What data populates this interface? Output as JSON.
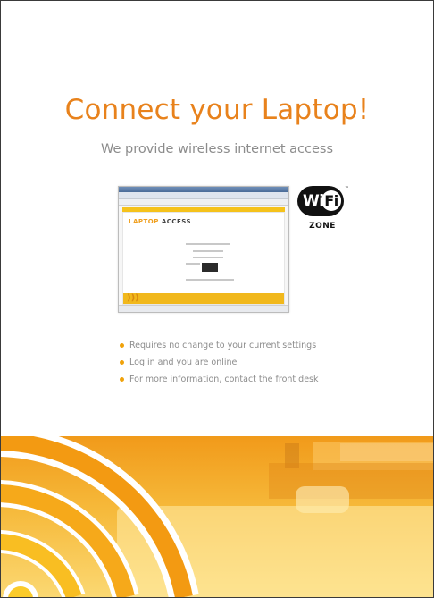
{
  "flyer": {
    "title": "Connect your Laptop!",
    "subtitle": "We provide wireless internet access"
  },
  "screenshot": {
    "brand_part1": "LAPTOP",
    "brand_part2": "ACCESS"
  },
  "wifi_logo": {
    "badge_wi": "Wi",
    "badge_fi": "Fi",
    "trademark": "™",
    "zone": "ZONE"
  },
  "bullets": [
    "Requires no change to your current settings",
    "Log in and you are online",
    "For more information, contact the front desk"
  ],
  "colors": {
    "accent": "#e8821c",
    "bullet": "#f0a20b",
    "text_gray": "#8c8c8c"
  }
}
